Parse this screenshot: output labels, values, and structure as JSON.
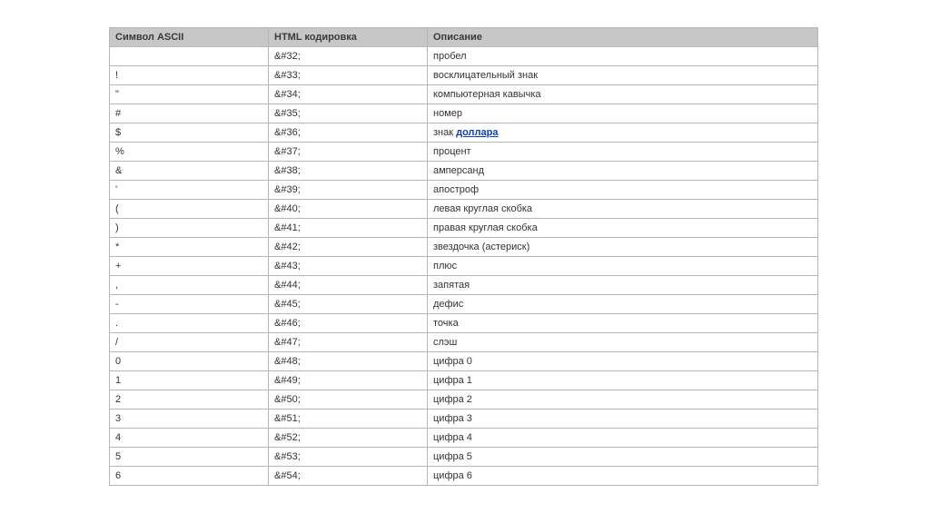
{
  "table": {
    "headers": {
      "col1": "Символ ASCII",
      "col2": "HTML кодировка",
      "col3": "Описание"
    },
    "rows": [
      {
        "symbol": "",
        "code": "&#32;",
        "desc": "пробел"
      },
      {
        "symbol": "!",
        "code": "&#33;",
        "desc": "восклицательный знак"
      },
      {
        "symbol": "\"",
        "code": "&#34;",
        "desc": "компьютерная кавычка"
      },
      {
        "symbol": "#",
        "code": "&#35;",
        "desc": "номер"
      },
      {
        "symbol": "$",
        "code": "&#36;",
        "desc_prefix": "знак ",
        "desc_link": "доллара"
      },
      {
        "symbol": "%",
        "code": "&#37;",
        "desc": "процент"
      },
      {
        "symbol": "&",
        "code": "&#38;",
        "desc": "амперсанд"
      },
      {
        "symbol": "'",
        "code": "&#39;",
        "desc": "апостроф"
      },
      {
        "symbol": "(",
        "code": "&#40;",
        "desc": "левая круглая скобка"
      },
      {
        "symbol": ")",
        "code": "&#41;",
        "desc": "правая круглая скобка"
      },
      {
        "symbol": "*",
        "code": "&#42;",
        "desc": "звездочка (астериск)"
      },
      {
        "symbol": "+",
        "code": "&#43;",
        "desc": "плюс"
      },
      {
        "symbol": ",",
        "code": "&#44;",
        "desc": "запятая"
      },
      {
        "symbol": "-",
        "code": "&#45;",
        "desc": "дефис"
      },
      {
        "symbol": ".",
        "code": "&#46;",
        "desc": "точка"
      },
      {
        "symbol": "/",
        "code": "&#47;",
        "desc": "слэш"
      },
      {
        "symbol": "0",
        "code": "&#48;",
        "desc": "цифра 0"
      },
      {
        "symbol": "1",
        "code": "&#49;",
        "desc": "цифра 1"
      },
      {
        "symbol": "2",
        "code": "&#50;",
        "desc": "цифра 2"
      },
      {
        "symbol": "3",
        "code": "&#51;",
        "desc": "цифра 3"
      },
      {
        "symbol": "4",
        "code": "&#52;",
        "desc": "цифра 4"
      },
      {
        "symbol": "5",
        "code": "&#53;",
        "desc": "цифра 5"
      },
      {
        "symbol": "6",
        "code": "&#54;",
        "desc": "цифра 6"
      }
    ]
  }
}
